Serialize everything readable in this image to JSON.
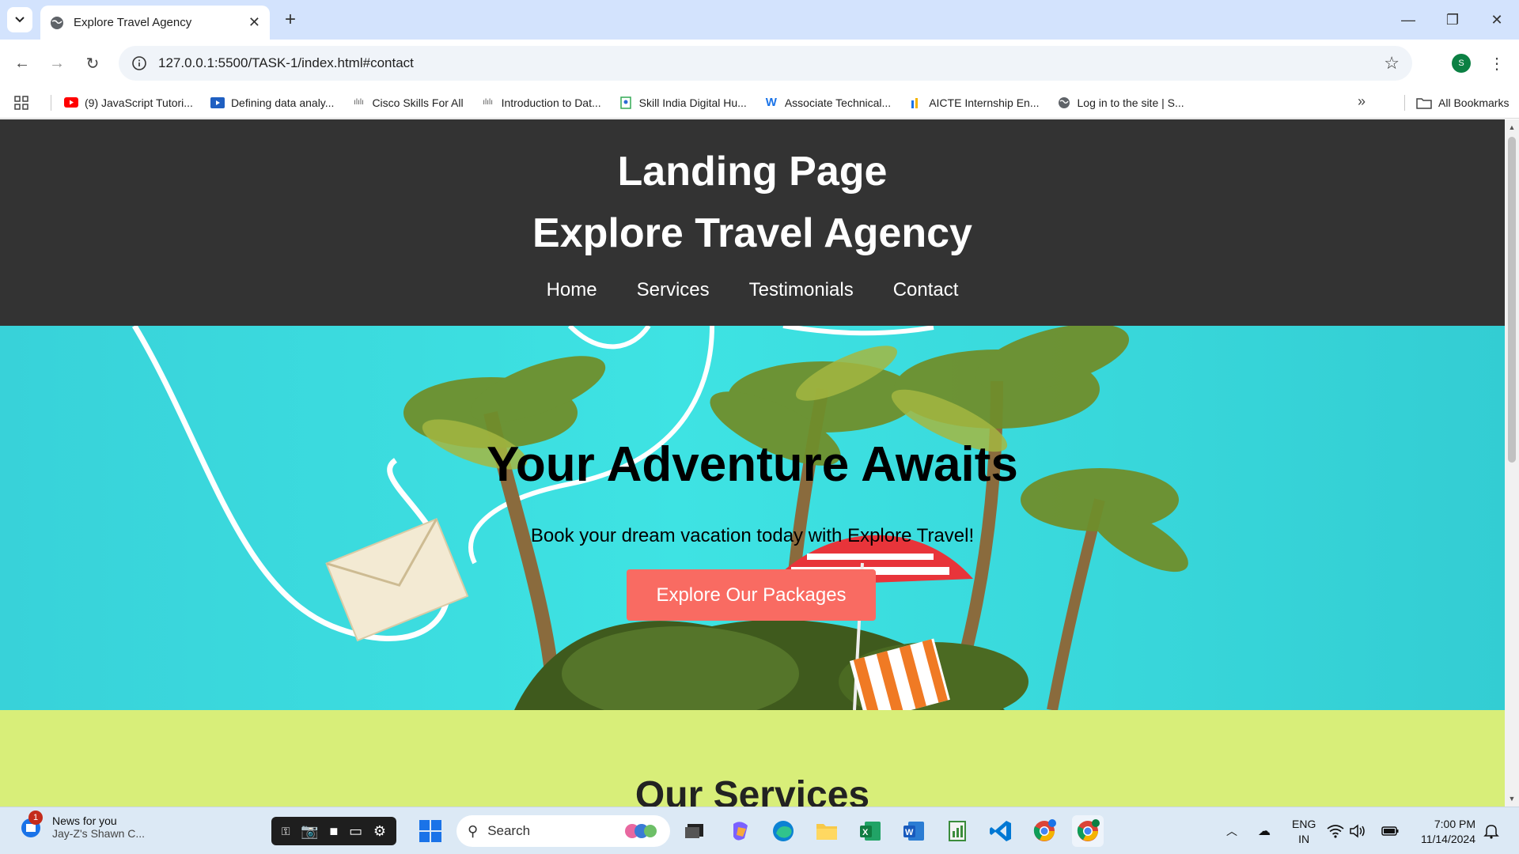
{
  "browser": {
    "tab_title": "Explore Travel Agency",
    "url": "127.0.0.1:5500/TASK-1/index.html#contact",
    "profile_initial": "S",
    "bookmarks": [
      {
        "label": "(9) JavaScript Tutori...",
        "icon": "youtube-icon"
      },
      {
        "label": "Defining data analy...",
        "icon": "coursera-icon"
      },
      {
        "label": "Cisco Skills For All",
        "icon": "cisco-icon"
      },
      {
        "label": "Introduction to Dat...",
        "icon": "cisco-icon"
      },
      {
        "label": "Skill India Digital Hu...",
        "icon": "skill-india-icon"
      },
      {
        "label": "Associate Technical...",
        "icon": "w-icon"
      },
      {
        "label": "AICTE Internship En...",
        "icon": "aicte-icon"
      },
      {
        "label": "Log in to the site | S...",
        "icon": "globe-icon"
      }
    ],
    "all_bookmarks_label": "All Bookmarks"
  },
  "page": {
    "header_title": "Landing Page",
    "site_title": "Explore Travel Agency",
    "nav": [
      "Home",
      "Services",
      "Testimonials",
      "Contact"
    ],
    "hero_title": "Your Adventure Awaits",
    "hero_subtitle": "Book your dream vacation today with Explore Travel!",
    "hero_button": "Explore Our Packages",
    "services_title": "Our Services"
  },
  "colors": {
    "header_bg": "#333333",
    "hero_bg": "#3ee3e3",
    "button_bg": "#f96b62",
    "services_bg": "#d8ee79"
  },
  "taskbar": {
    "news_title": "News for you",
    "news_subtitle": "Jay-Z's Shawn C...",
    "news_badge": "1",
    "search_placeholder": "Search",
    "lang_line1": "ENG",
    "lang_line2": "IN",
    "time": "7:00 PM",
    "date": "11/14/2024"
  }
}
